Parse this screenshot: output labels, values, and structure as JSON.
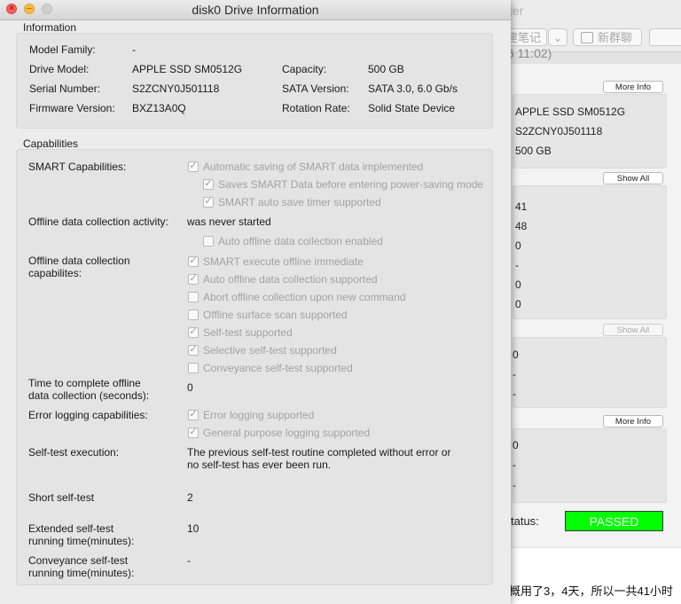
{
  "background_window": {
    "title_fragment": "ter",
    "toolbar": {
      "note_button": "建笔记",
      "chevron": "⌄",
      "new_group_button": "新群聊"
    },
    "time_fragment": "6 11:02)",
    "info_panel": {
      "button": "More Info",
      "values": [
        "APPLE SSD SM0512G",
        "S2ZCNY0J501118",
        "500 GB"
      ]
    },
    "attrs_panel": {
      "button": "Show All",
      "values": [
        "41",
        "48",
        "0",
        "-",
        "0",
        "0"
      ]
    },
    "errors_panel": {
      "button": "Show All",
      "values": [
        "0",
        "-",
        "-"
      ]
    },
    "selftest_panel": {
      "button": "More Info",
      "values": [
        "0",
        "-",
        "-"
      ]
    },
    "status": {
      "label": "Status:",
      "fragment": "tatus:",
      "value": "PASSED",
      "color": "#00ff00"
    },
    "bottom_text": "概用了3，4天，所以一共41小时"
  },
  "window": {
    "title": "disk0 Drive Information",
    "information": {
      "title": "Information",
      "model_family": {
        "label": "Model Family:",
        "value": "-"
      },
      "drive_model": {
        "label": "Drive Model:",
        "value": "APPLE SSD SM0512G"
      },
      "serial": {
        "label": "Serial Number:",
        "value": "S2ZCNY0J501118"
      },
      "firmware": {
        "label": "Firmware Version:",
        "value": "BXZ13A0Q"
      },
      "capacity": {
        "label": "Capacity:",
        "value": "500 GB"
      },
      "sata": {
        "label": "SATA Version:",
        "value": "SATA 3.0, 6.0 Gb/s"
      },
      "rotation": {
        "label": "Rotation Rate:",
        "value": "Solid State Device"
      }
    },
    "capabilities": {
      "title": "Capabilities",
      "smart": {
        "label": "SMART Capabilities:",
        "items": [
          {
            "text": "Automatic saving of SMART data implemented",
            "checked": true
          },
          {
            "text": "Saves SMART Data before entering power-saving mode",
            "checked": true
          },
          {
            "text": "SMART auto save timer supported",
            "checked": true
          }
        ]
      },
      "offline_activity": {
        "label": "Offline data collection activity:",
        "value": "was never started",
        "items": [
          {
            "text": "Auto offline data collection enabled",
            "checked": false
          }
        ]
      },
      "offline_caps": {
        "label": "Offline data collection capabilites:",
        "items": [
          {
            "text": "SMART execute offline immediate",
            "checked": true
          },
          {
            "text": "Auto offline data collection supported",
            "checked": true
          },
          {
            "text": "Abort offline collection upon new command",
            "checked": false
          },
          {
            "text": "Offline surface scan supported",
            "checked": false
          },
          {
            "text": "Self-test supported",
            "checked": true
          },
          {
            "text": "Selective self-test supported",
            "checked": true
          },
          {
            "text": "Conveyance self-test supported",
            "checked": false
          }
        ]
      },
      "time_offline": {
        "label": "Time to complete offline data collection (seconds):",
        "value": "0"
      },
      "error_logging": {
        "label": "Error logging capabilities:",
        "items": [
          {
            "text": "Error logging supported",
            "checked": true
          },
          {
            "text": "General purpose logging supported",
            "checked": true
          }
        ]
      },
      "selftest_exec": {
        "label": "Self-test execution:",
        "value": "The previous self-test routine completed without error or no self-test has ever been run."
      },
      "short_selftest": {
        "label": "Short self-test",
        "value": "2"
      },
      "extended_selftest": {
        "label": "Extended self-test running time(minutes):",
        "value": "10"
      },
      "conveyance_selftest": {
        "label": "Conveyance self-test running time(minutes):",
        "value": "-"
      }
    }
  }
}
